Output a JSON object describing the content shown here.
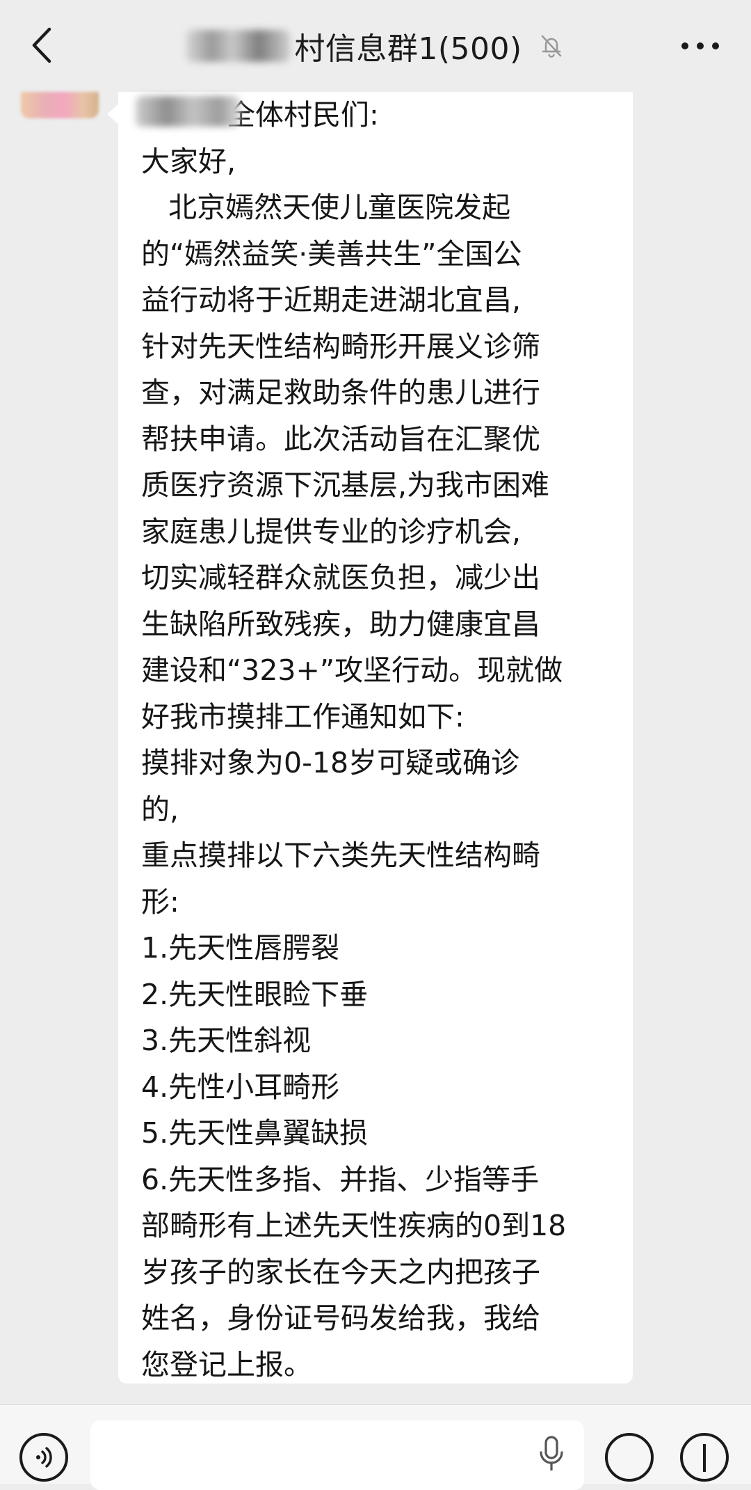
{
  "header": {
    "title": "村信息群1(500)",
    "back_icon": "chevron-left-icon",
    "mute_icon": "bell-off-icon",
    "more_icon": "ellipsis-icon"
  },
  "message": {
    "text": "　　　全体村民们:\n大家好,\n   北京嫣然天使儿童医院发起\n的“嫣然益笑·美善共生”全国公\n益行动将于近期走进湖北宜昌,\n针对先天性结构畸形开展义诊筛\n查，对满足救助条件的患儿进行\n帮扶申请。此次活动旨在汇聚优\n质医疗资源下沉基层,为我市困难\n家庭患儿提供专业的诊疗机会,\n切实减轻群众就医负担，减少出\n生缺陷所致残疾，助力健康宜昌\n建设和“323+”攻坚行动。现就做\n好我市摸排工作通知如下:\n摸排对象为0-18岁可疑或确诊\n的,\n重点摸排以下六类先天性结构畸\n形:\n1.先天性唇腭裂\n2.先天性眼睑下垂\n3.先天性斜视\n4.先性小耳畸形\n5.先天性鼻翼缺损\n6.先天性多指、并指、少指等手\n部畸形有上述先天性疾病的0到18\n岁孩子的家长在今天之内把孩子\n姓名，身份证号码发给我，我给\n您登记上报。"
  },
  "input_bar": {
    "voice_icon": "voice-icon",
    "mic_icon": "microphone-icon",
    "emoji_icon": "emoji-icon",
    "plus_icon": "plus-icon"
  },
  "colors": {
    "background": "#ededed",
    "bubble": "#ffffff",
    "text": "#161616"
  }
}
